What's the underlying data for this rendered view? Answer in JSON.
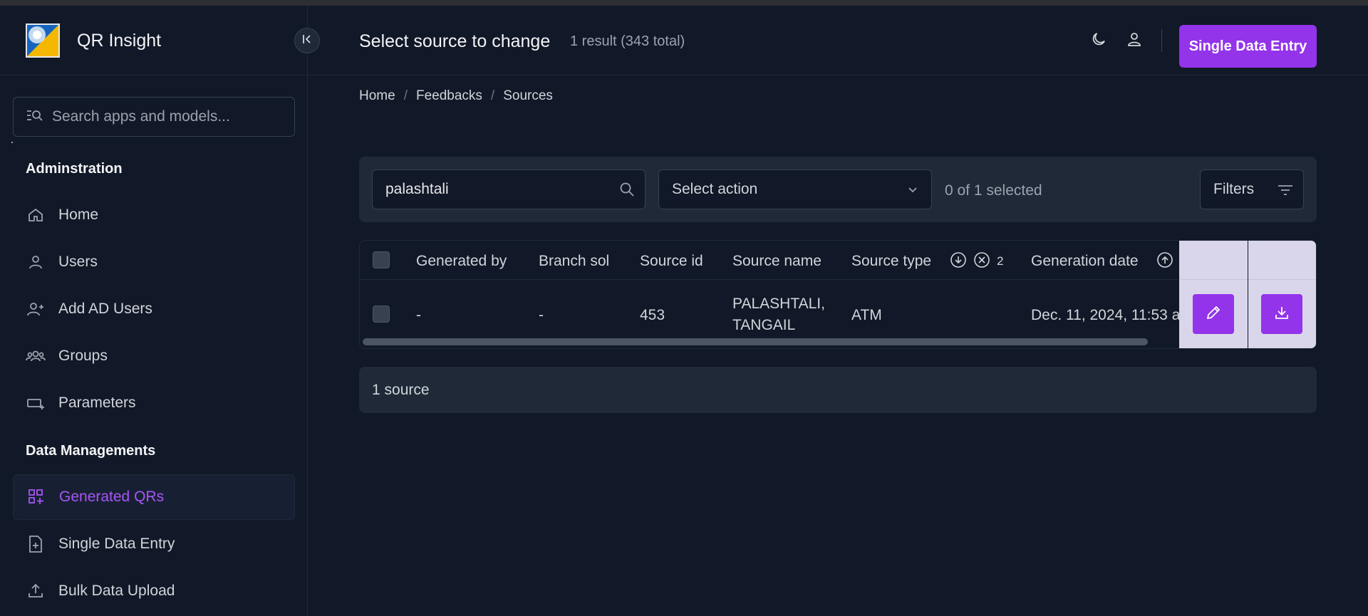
{
  "app": {
    "name": "QR Insight"
  },
  "sidebar": {
    "search_placeholder": "Search apps and models...",
    "sections": [
      {
        "title": "Adminstration",
        "items": [
          {
            "label": "Home",
            "icon": "home-icon"
          },
          {
            "label": "Users",
            "icon": "user-icon"
          },
          {
            "label": "Add AD Users",
            "icon": "user-plus-icon"
          },
          {
            "label": "Groups",
            "icon": "groups-icon"
          },
          {
            "label": "Parameters",
            "icon": "parameters-icon"
          }
        ]
      },
      {
        "title": "Data Managements",
        "items": [
          {
            "label": "Generated QRs",
            "icon": "qr-code-icon",
            "active": true
          },
          {
            "label": "Single Data Entry",
            "icon": "file-plus-icon"
          },
          {
            "label": "Bulk Data Upload",
            "icon": "upload-icon"
          }
        ]
      }
    ]
  },
  "header": {
    "title": "Select source to change",
    "subtitle": "1 result (343 total)",
    "primary_button": "Single Data Entry"
  },
  "breadcrumb": [
    "Home",
    "Feedbacks",
    "Sources"
  ],
  "toolbar": {
    "search_value": "palashtali",
    "action_select": "Select action",
    "selected_count": "0 of 1 selected",
    "filters_label": "Filters"
  },
  "table": {
    "columns": [
      "Generated by",
      "Branch sol",
      "Source id",
      "Source name",
      "Source type",
      "Generation date"
    ],
    "source_type_sort_priority": "2",
    "rows": [
      {
        "generated_by": "-",
        "branch_sol": "-",
        "source_id": "453",
        "source_name_line1": "PALASHTALI,",
        "source_name_line2": "TANGAIL",
        "source_type": "ATM",
        "generation_date": "Dec. 11, 2024, 11:53 a"
      }
    ]
  },
  "footer": {
    "count": "1 source"
  },
  "colors": {
    "background": "#111827",
    "panel": "#1f2937",
    "accent": "#9333ea",
    "active_text": "#a855f7",
    "actions_panel": "#d9d6ec"
  }
}
